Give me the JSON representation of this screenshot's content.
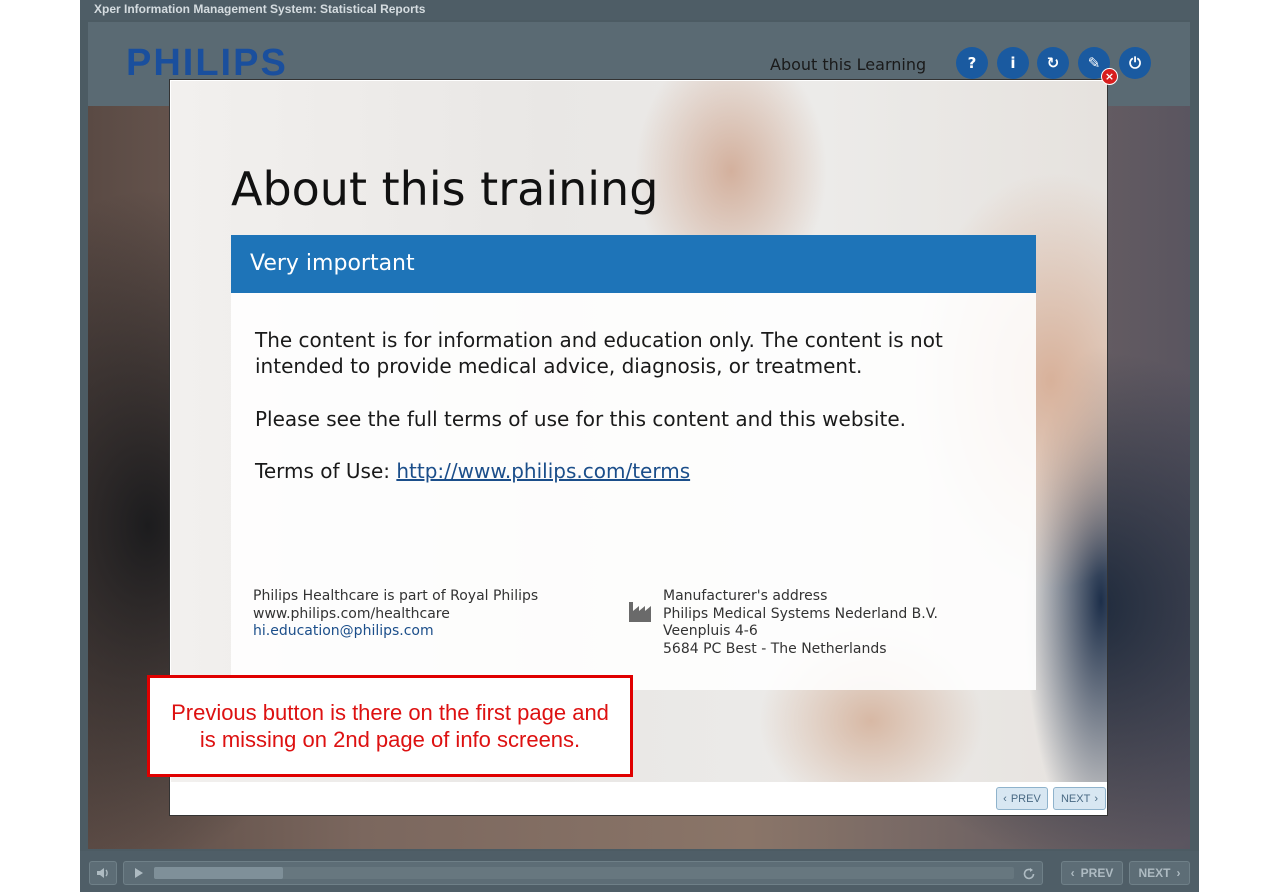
{
  "window": {
    "title": "Xper Information Management System: Statistical Reports"
  },
  "header": {
    "logo_text": "PHILIPS",
    "about_label": "About this Learning",
    "buttons": [
      {
        "icon": "help-icon",
        "glyph": "?"
      },
      {
        "icon": "info-icon",
        "glyph": "i"
      },
      {
        "icon": "refresh-icon",
        "glyph": "↻"
      },
      {
        "icon": "compass-icon",
        "glyph": "✎"
      },
      {
        "icon": "power-icon",
        "glyph": "⏻"
      }
    ]
  },
  "modal": {
    "title": "About this training",
    "panel_heading": "Very important",
    "paragraph1": "The content is for information and education only. The content is not intended to provide medical advice, diagnosis, or treatment.",
    "paragraph2": "Please see the full terms of use for this content and this website.",
    "terms_label": "Terms of Use: ",
    "terms_link": "http://www.philips.com/terms",
    "footer_left": {
      "line1": "Philips Healthcare is part of Royal Philips",
      "line2": "www.philips.com/healthcare",
      "email": "hi.education@philips.com"
    },
    "footer_right": {
      "heading": "Manufacturer's address",
      "line1": "Philips Medical Systems Nederland B.V.",
      "line2": "Veenpluis 4-6",
      "line3": "5684 PC Best - The Netherlands"
    },
    "close_glyph": "×",
    "prev_label": "PREV",
    "next_label": "NEXT"
  },
  "annotation": {
    "text": "Previous button is there on the first page and is missing on 2nd page of info screens."
  },
  "toolbar": {
    "prev_label": "PREV",
    "next_label": "NEXT",
    "progress": 0.15
  },
  "colors": {
    "brand_blue": "#1a4f9d",
    "panel_blue": "#1e74b8",
    "annotation_red": "#e00000"
  }
}
